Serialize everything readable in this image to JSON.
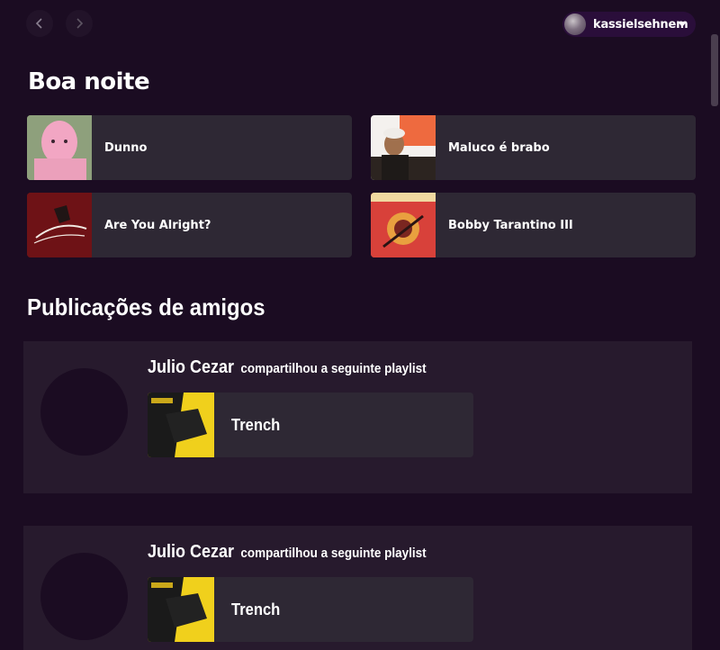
{
  "header": {
    "back_icon": "chevron-left-icon",
    "forward_icon": "chevron-right-icon",
    "user": {
      "name": "kassielsehnem",
      "caret_icon": "caret-down-icon"
    }
  },
  "greeting": "Boa noite",
  "shortcuts": [
    {
      "label": "Dunno"
    },
    {
      "label": "Maluco é brabo"
    },
    {
      "label": "Are You Alright?"
    },
    {
      "label": "Bobby Tarantino III"
    }
  ],
  "friends": {
    "title": "Publicações de amigos",
    "posts": [
      {
        "author": "Julio Cezar",
        "action": "compartilhou a seguinte playlist",
        "playlist": "Trench"
      },
      {
        "author": "Julio Cezar",
        "action": "compartilhou a seguinte playlist",
        "playlist": "Trench"
      }
    ]
  },
  "colors": {
    "background": "#1b0c22",
    "card": "#2e2834",
    "post_panel": "#271a2d",
    "user_pill": "#2a0e3a"
  }
}
